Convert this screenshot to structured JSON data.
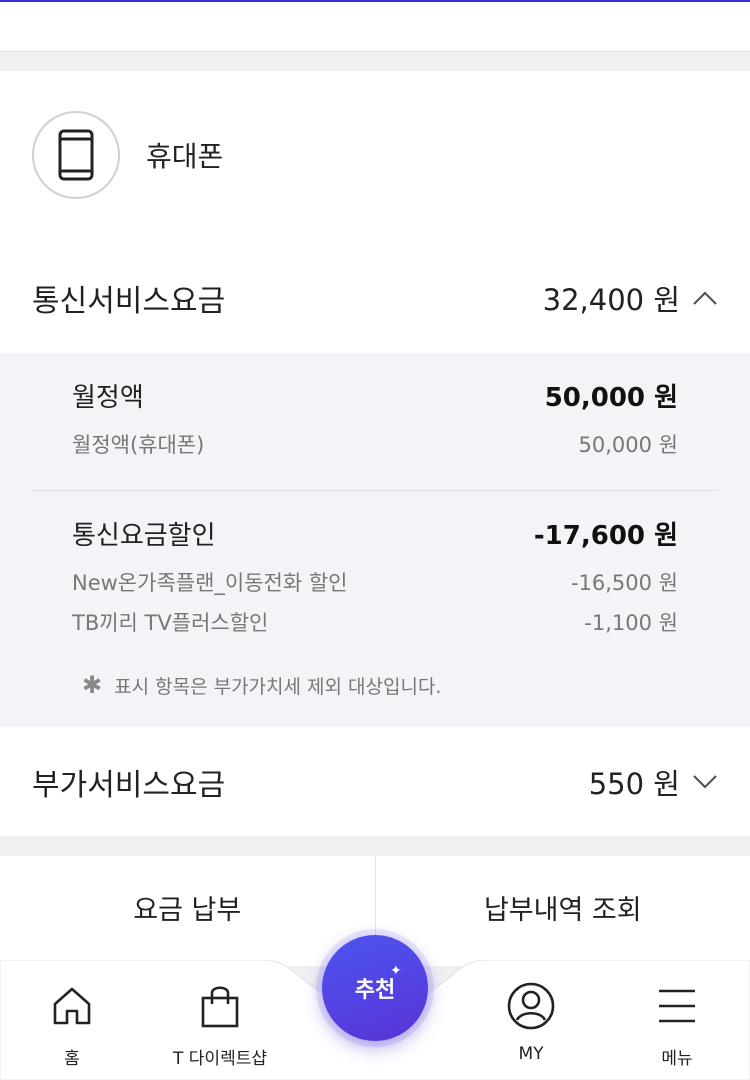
{
  "device": {
    "label": "휴대폰",
    "icon": "phone-icon"
  },
  "telecom_section": {
    "title": "통신서비스요금",
    "amount": "32,400 원",
    "state_icon": "chevron-up-icon",
    "items": [
      {
        "label": "월정액",
        "amount": "50,000 원",
        "subitems": [
          {
            "label": "월정액(휴대폰)",
            "amount": "50,000 원"
          }
        ]
      },
      {
        "label": "통신요금할인",
        "amount": "-17,600 원",
        "subitems": [
          {
            "label": "New온가족플랜_이동전화 할인",
            "amount": "-16,500 원"
          },
          {
            "label": "TB끼리 TV플러스할인",
            "amount": "-1,100 원"
          }
        ]
      }
    ],
    "note": "표시 항목은 부가가치세 제외 대상입니다."
  },
  "addon_section": {
    "title": "부가서비스요금",
    "amount": "550 원",
    "state_icon": "chevron-down-icon"
  },
  "actions": {
    "pay": "요금 납부",
    "history": "납부내역 조회"
  },
  "tabbar": {
    "home": "홈",
    "shop": "T 다이렉트샵",
    "recommend": "추천",
    "my": "MY",
    "menu": "메뉴"
  },
  "colors": {
    "accent": "#4b47e6",
    "detail_bg": "#f3f4f7"
  }
}
